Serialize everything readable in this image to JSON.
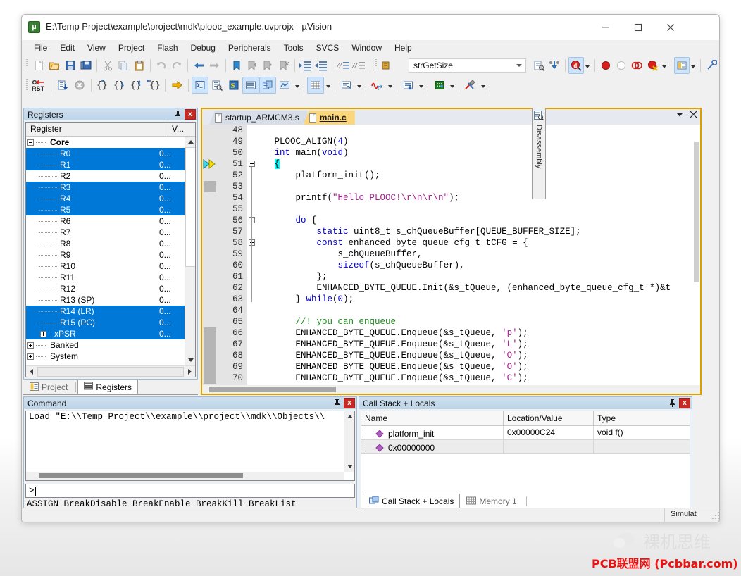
{
  "window": {
    "title": "E:\\Temp Project\\example\\project\\mdk\\plooc_example.uvprojx - µVision",
    "icon": "uvision-icon",
    "minimize": "–",
    "maximize": "□",
    "close": "✕"
  },
  "menubar": [
    {
      "label": "File"
    },
    {
      "label": "Edit"
    },
    {
      "label": "View"
    },
    {
      "label": "Project"
    },
    {
      "label": "Flash"
    },
    {
      "label": "Debug"
    },
    {
      "label": "Peripherals"
    },
    {
      "label": "Tools"
    },
    {
      "label": "SVCS"
    },
    {
      "label": "Window"
    },
    {
      "label": "Help"
    }
  ],
  "toolbar_top": [
    {
      "name": "new-file-icon"
    },
    {
      "name": "open-file-icon"
    },
    {
      "name": "save-icon"
    },
    {
      "name": "save-all-icon"
    },
    {
      "name": "cut-icon"
    },
    {
      "name": "copy-icon"
    },
    {
      "name": "paste-icon"
    },
    {
      "name": "undo-icon"
    },
    {
      "name": "redo-icon"
    },
    {
      "name": "navigate-back-icon"
    },
    {
      "name": "navigate-forward-icon"
    },
    {
      "name": "bookmark-toggle-icon"
    },
    {
      "name": "bookmark-prev-icon"
    },
    {
      "name": "bookmark-next-icon"
    },
    {
      "name": "bookmark-clear-icon"
    },
    {
      "name": "indent-icon"
    },
    {
      "name": "outdent-icon"
    },
    {
      "name": "comment-icon"
    },
    {
      "name": "uncomment-icon"
    }
  ],
  "toolbar_debug": {
    "reset_label": "RST",
    "combo_value": "strGetSize",
    "buttons": [
      {
        "name": "reset-cpu-icon"
      },
      {
        "name": "run-icon"
      },
      {
        "name": "stop-icon"
      },
      {
        "name": "step-icon"
      },
      {
        "name": "step-over-icon"
      },
      {
        "name": "step-out-icon"
      },
      {
        "name": "run-to-cursor-icon"
      },
      {
        "name": "show-next-statement-icon"
      },
      {
        "name": "command-window-icon"
      },
      {
        "name": "disassembly-window-icon"
      },
      {
        "name": "symbols-window-icon"
      },
      {
        "name": "registers-window-icon"
      },
      {
        "name": "call-stack-window-icon"
      },
      {
        "name": "watch-window-icon"
      },
      {
        "name": "memory-window-icon"
      },
      {
        "name": "serial-window-icon"
      },
      {
        "name": "analysis-window-icon"
      },
      {
        "name": "trace-window-icon"
      },
      {
        "name": "system-viewer-icon"
      },
      {
        "name": "toolbox-icon"
      },
      {
        "name": "breakpoint-icon"
      },
      {
        "name": "disable-breakpoint-icon"
      },
      {
        "name": "disable-all-breakpoints-icon"
      },
      {
        "name": "kill-all-breakpoints-icon"
      },
      {
        "name": "debug-settings-icon"
      },
      {
        "name": "configure-icon"
      }
    ]
  },
  "registers_panel": {
    "title": "Registers",
    "pin": "⌷",
    "close": "x",
    "columns": [
      "Register",
      "V..."
    ],
    "rows": [
      {
        "name": "Core",
        "value": "",
        "level": 0,
        "expander": "minus",
        "bold": true,
        "selected": false
      },
      {
        "name": "R0",
        "value": "0...",
        "level": 1,
        "expander": "",
        "bold": false,
        "selected": true
      },
      {
        "name": "R1",
        "value": "0...",
        "level": 1,
        "expander": "",
        "bold": false,
        "selected": true
      },
      {
        "name": "R2",
        "value": "0...",
        "level": 1,
        "expander": "",
        "bold": false,
        "selected": false
      },
      {
        "name": "R3",
        "value": "0...",
        "level": 1,
        "expander": "",
        "bold": false,
        "selected": true
      },
      {
        "name": "R4",
        "value": "0...",
        "level": 1,
        "expander": "",
        "bold": false,
        "selected": true
      },
      {
        "name": "R5",
        "value": "0...",
        "level": 1,
        "expander": "",
        "bold": false,
        "selected": true
      },
      {
        "name": "R6",
        "value": "0...",
        "level": 1,
        "expander": "",
        "bold": false,
        "selected": false
      },
      {
        "name": "R7",
        "value": "0...",
        "level": 1,
        "expander": "",
        "bold": false,
        "selected": false
      },
      {
        "name": "R8",
        "value": "0...",
        "level": 1,
        "expander": "",
        "bold": false,
        "selected": false
      },
      {
        "name": "R9",
        "value": "0...",
        "level": 1,
        "expander": "",
        "bold": false,
        "selected": false
      },
      {
        "name": "R10",
        "value": "0...",
        "level": 1,
        "expander": "",
        "bold": false,
        "selected": false
      },
      {
        "name": "R11",
        "value": "0...",
        "level": 1,
        "expander": "",
        "bold": false,
        "selected": false
      },
      {
        "name": "R12",
        "value": "0...",
        "level": 1,
        "expander": "",
        "bold": false,
        "selected": false
      },
      {
        "name": "R13 (SP)",
        "value": "0...",
        "level": 1,
        "expander": "",
        "bold": false,
        "selected": false
      },
      {
        "name": "R14 (LR)",
        "value": "0...",
        "level": 1,
        "expander": "",
        "bold": false,
        "selected": true
      },
      {
        "name": "R15 (PC)",
        "value": "0...",
        "level": 1,
        "expander": "",
        "bold": false,
        "selected": true
      },
      {
        "name": "xPSR",
        "value": "0...",
        "level": 1,
        "expander": "plus",
        "bold": false,
        "selected": true
      },
      {
        "name": "Banked",
        "value": "",
        "level": 0,
        "expander": "plus",
        "bold": false,
        "selected": false
      },
      {
        "name": "System",
        "value": "",
        "level": 0,
        "expander": "plus",
        "bold": false,
        "selected": false
      }
    ],
    "dock_tabs": [
      {
        "label": "Project",
        "icon": "project-icon",
        "active": false
      },
      {
        "label": "Registers",
        "icon": "registers-icon",
        "active": true
      }
    ]
  },
  "editor": {
    "tabs": [
      {
        "label": "startup_ARMCM3.s",
        "active": false,
        "icon": "document-icon"
      },
      {
        "label": "main.c",
        "active": true,
        "icon": "document-icon"
      }
    ],
    "tab_menu_icon": "chevron-down-icon",
    "tab_close_icon": "close-icon",
    "first_line": 48,
    "lines": [
      {
        "n": 48,
        "html": ""
      },
      {
        "n": 49,
        "html": "   PLOOC_ALIGN(<span class='num'>4</span>)"
      },
      {
        "n": 50,
        "html": "   <span class='kw'>int</span> main(<span class='kw'>void</span>)"
      },
      {
        "n": 51,
        "html": "   <span class='hl'>{</span>",
        "fold": "minus",
        "pc": true
      },
      {
        "n": 52,
        "html": "       platform_init();"
      },
      {
        "n": 53,
        "html": "",
        "marker": true
      },
      {
        "n": 54,
        "html": "       printf(<span class='str'>\"Hello PLOOC!\\r\\n\\r\\n\"</span>);"
      },
      {
        "n": 55,
        "html": ""
      },
      {
        "n": 56,
        "html": "       <span class='kw'>do</span> {",
        "fold": "minus"
      },
      {
        "n": 57,
        "html": "           <span class='kw'>static</span> uint8_t s_chQueueBuffer[QUEUE_BUFFER_SIZE];"
      },
      {
        "n": 58,
        "html": "           <span class='kw'>const</span> enhanced_byte_queue_cfg_t tCFG = {",
        "fold": "minus"
      },
      {
        "n": 59,
        "html": "               s_chQueueBuffer,"
      },
      {
        "n": 60,
        "html": "               <span class='kw'>sizeof</span>(s_chQueueBuffer),"
      },
      {
        "n": 61,
        "html": "           };"
      },
      {
        "n": 62,
        "html": "           ENHANCED_BYTE_QUEUE.Init(&amp;s_tQueue, (enhanced_byte_queue_cfg_t *)&amp;t"
      },
      {
        "n": 63,
        "html": "       } <span class='kw'>while</span>(<span class='num'>0</span>);"
      },
      {
        "n": 64,
        "html": ""
      },
      {
        "n": 65,
        "html": "       <span class='cmt'>//! you can enqueue</span>"
      },
      {
        "n": 66,
        "html": "       ENHANCED_BYTE_QUEUE.Enqueue(&amp;s_tQueue, <span class='str'>'p'</span>);"
      },
      {
        "n": 67,
        "html": "       ENHANCED_BYTE_QUEUE.Enqueue(&amp;s_tQueue, <span class='str'>'L'</span>);"
      },
      {
        "n": 68,
        "html": "       ENHANCED_BYTE_QUEUE.Enqueue(&amp;s_tQueue, <span class='str'>'O'</span>);"
      },
      {
        "n": 69,
        "html": "       ENHANCED_BYTE_QUEUE.Enqueue(&amp;s_tQueue, <span class='str'>'O'</span>);"
      },
      {
        "n": 70,
        "html": "       ENHANCED_BYTE_QUEUE.Enqueue(&amp;s_tQueue, <span class='str'>'C'</span>);"
      }
    ]
  },
  "disassembly": {
    "label": "Disassembly",
    "icon": "disassembly-icon"
  },
  "command_panel": {
    "title": "Command",
    "pin": "⌷",
    "close": "x",
    "output": "Load \"E:\\\\Temp Project\\\\example\\\\project\\\\mdk\\\\Objects\\\\",
    "prompt": ">",
    "input_value": "",
    "hints": "ASSIGN BreakDisable BreakEnable BreakKill BreakList"
  },
  "callstack_panel": {
    "title": "Call Stack + Locals",
    "pin": "⌷",
    "close": "x",
    "columns": [
      "Name",
      "Location/Value",
      "Type"
    ],
    "rows": [
      {
        "name": "platform_init",
        "location": "0x00000C24",
        "type": "void f()"
      },
      {
        "name": "0x00000000",
        "location": "",
        "type": ""
      }
    ],
    "dock_tabs": [
      {
        "label": "Call Stack + Locals",
        "icon": "call-stack-icon",
        "active": true
      },
      {
        "label": "Memory 1",
        "icon": "memory-icon",
        "active": false
      }
    ]
  },
  "statusbar": {
    "cells": [
      {
        "text": "Simulat"
      }
    ],
    "resize_grip": "resize-grip"
  },
  "watermark": {
    "wechat_icon": "wechat-icon",
    "top_text": "裸机思维",
    "bottom_text": "PCB联盟网 (Pcbbar.com)",
    "top_color": "#dedede",
    "bottom_color": "#ee1111"
  }
}
